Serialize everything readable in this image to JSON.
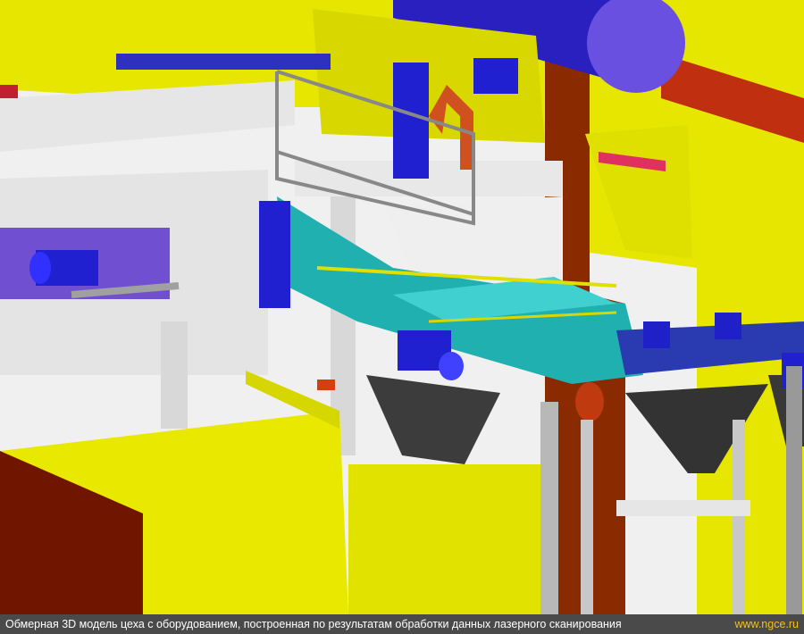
{
  "caption": {
    "text": "Обмерная 3D модель цеха с оборудованием, построенная по результатам обработки данных лазерного сканирования",
    "site": "www.ngce.ru"
  },
  "palette": {
    "structure_yellow": "#e6e600",
    "steel_white": "#e4e4e4",
    "motor_blue": "#2020c8",
    "conveyor_teal": "#20b0b0",
    "hopper_dark": "#3a3a3a",
    "wall_brown": "#7a1800",
    "duct_purple": "#6a3ad0"
  }
}
